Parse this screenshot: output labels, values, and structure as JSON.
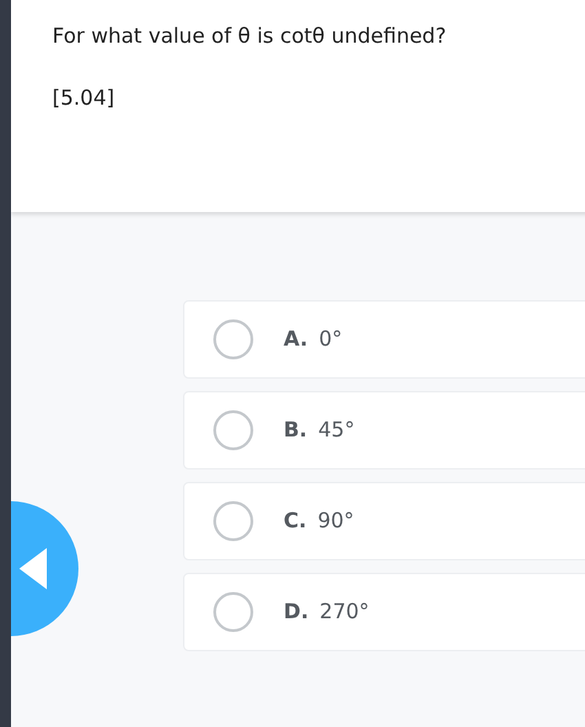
{
  "question": {
    "text": "For what value of θ is cotθ undefined?",
    "reference": "[5.04]"
  },
  "options": [
    {
      "letter": "A.",
      "text": "0°",
      "selected": false
    },
    {
      "letter": "B.",
      "text": "45°",
      "selected": false
    },
    {
      "letter": "C.",
      "text": "90°",
      "selected": false
    },
    {
      "letter": "D.",
      "text": "270°",
      "selected": false
    }
  ]
}
